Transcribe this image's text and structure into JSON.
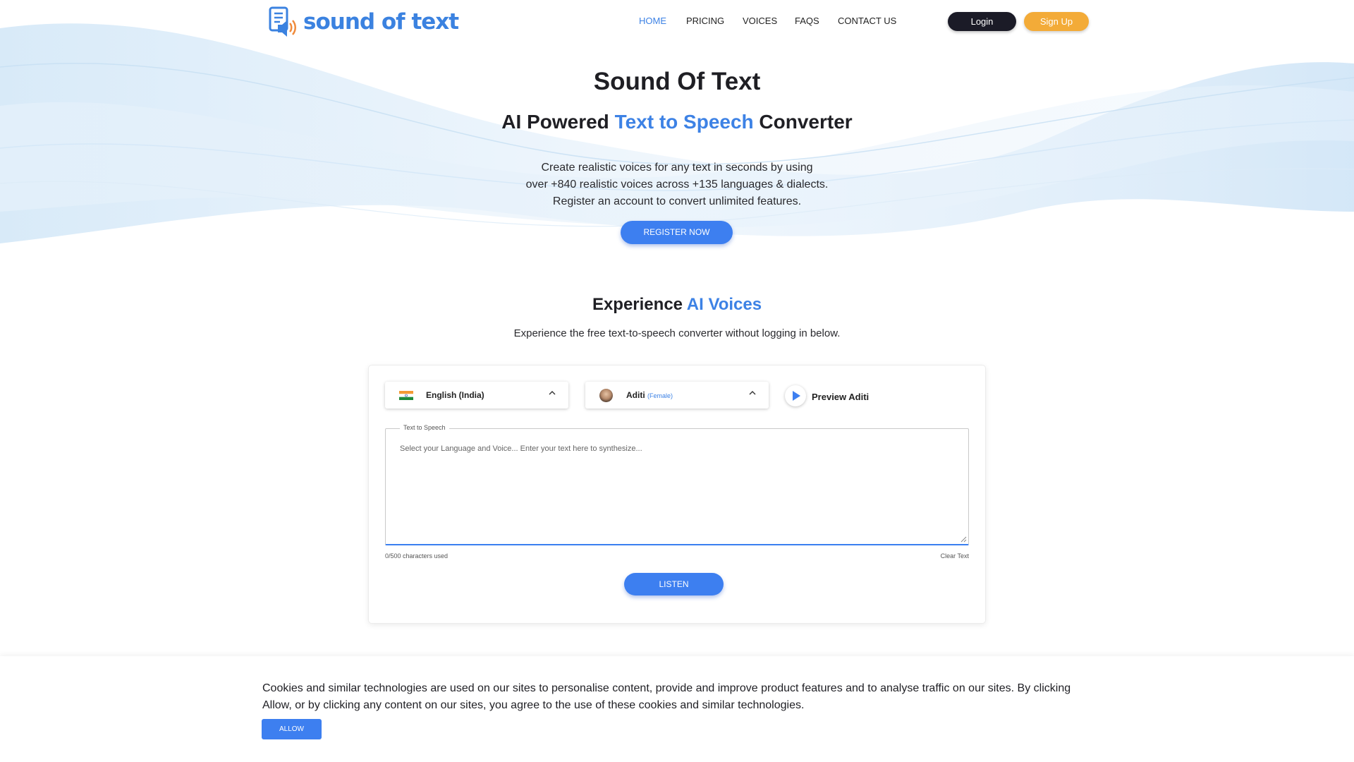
{
  "brand": {
    "logo_text": "sound of text"
  },
  "nav": {
    "items": [
      {
        "label": "HOME",
        "active": true
      },
      {
        "label": "PRICING",
        "active": false
      },
      {
        "label": "VOICES",
        "active": false
      },
      {
        "label": "FAQS",
        "active": false
      },
      {
        "label": "CONTACT US",
        "active": false
      }
    ],
    "login_label": "Login",
    "signup_label": "Sign Up"
  },
  "hero": {
    "title": "Sound Of Text",
    "subtitle_prefix": "AI Powered ",
    "subtitle_highlight": "Text to Speech",
    "subtitle_suffix": " Converter",
    "description_lines": [
      "Create realistic voices for any text in seconds by using",
      "over +840 realistic voices across +135 languages & dialects.",
      "Register an account to convert unlimited features."
    ],
    "cta_label": "REGISTER NOW"
  },
  "experience": {
    "title_prefix": "Experience ",
    "title_highlight": "AI Voices",
    "description": "Experience the free text-to-speech converter without logging in below."
  },
  "converter": {
    "language": {
      "value": "English (India)",
      "icon": "india-flag-icon"
    },
    "voice": {
      "name": "Aditi",
      "gender": "(Female)"
    },
    "preview_label": "Preview Aditi",
    "textarea_legend": "Text to Speech",
    "textarea_placeholder": "Select your Language and Voice... Enter your text here to synthesize...",
    "char_count": "0/500 characters used",
    "clear_label": "Clear Text",
    "listen_label": "LISTEN"
  },
  "cookie": {
    "text": "Cookies and similar technologies are used on our sites to personalise content, provide and improve product features and to analyse traffic on our sites. By clicking Allow, or by clicking any content on our sites, you agree to the use of these cookies and similar technologies.",
    "allow_label": "ALLOW"
  },
  "colors": {
    "accent": "#3d82e5",
    "login_bg": "#1b1b27",
    "signup_bg": "#f3ab38",
    "button_blue": "#3d7ff0"
  }
}
